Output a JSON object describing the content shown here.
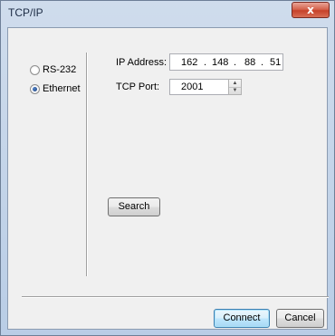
{
  "window": {
    "title": "TCP/IP",
    "close_label": "x"
  },
  "connection": {
    "options": [
      {
        "label": "RS-232",
        "selected": false
      },
      {
        "label": "Ethernet",
        "selected": true
      }
    ]
  },
  "form": {
    "ip_label": "IP Address:",
    "ip_octets": [
      "162",
      "148",
      "88",
      "51"
    ],
    "ip_separator": ".",
    "port_label": "TCP Port:",
    "port_value": "2001"
  },
  "buttons": {
    "search": "Search",
    "connect": "Connect",
    "cancel": "Cancel"
  },
  "icons": {
    "close": "close-icon",
    "spin_up": "spin-up-icon",
    "spin_down": "spin-down-icon"
  },
  "colors": {
    "title_bar": "#c4d5ea",
    "close_button": "#c6412a",
    "client_bg": "#f0f0f0",
    "default_button_border": "#3c7fb1"
  }
}
